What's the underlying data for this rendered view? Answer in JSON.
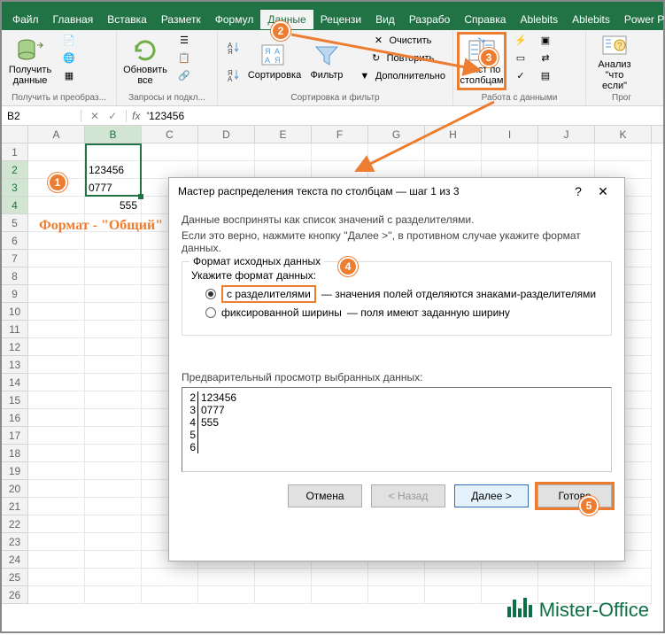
{
  "tabs": {
    "file": "Файл",
    "home": "Главная",
    "insert": "Вставка",
    "layout": "Разметк",
    "formulas": "Формул",
    "data": "Данные",
    "review": "Рецензи",
    "view": "Вид",
    "dev": "Разрабо",
    "help": "Справка",
    "ab1": "Ablebits",
    "ab2": "Ablebits",
    "pp": "Power Pi"
  },
  "ribbon": {
    "get_data": "Получить\nданные",
    "refresh": "Обновить\nвсе",
    "sort": "Сортировка",
    "filter": "Фильтр",
    "clear": "Очистить",
    "reapply": "Повторить",
    "advanced": "Дополнительно",
    "text_to_columns": "Текст по\nстолбцам",
    "whatif": "Анализ \"что\nесли\"",
    "group_get": "Получить и преобраз...",
    "group_queries": "Запросы и подкл...",
    "group_sort": "Сортировка и фильтр",
    "group_datatools": "Работа с данными",
    "group_forecast": "Прог"
  },
  "namebox": "B2",
  "formula": "'123456",
  "columns": [
    "A",
    "B",
    "C",
    "D",
    "E",
    "F",
    "G",
    "H",
    "I",
    "J",
    "K"
  ],
  "cells": {
    "B2": "123456",
    "B3": "0777",
    "B4": "555"
  },
  "annotation": "Формат - \"Общий\"",
  "dialog": {
    "title": "Мастер распределения текста по столбцам — шаг 1 из 3",
    "desc1": "Данные восприняты как список значений с разделителями.",
    "desc2": "Если это верно, нажмите кнопку ''Далее >'', в противном случае укажите формат данных.",
    "legend": "Формат исходных данных",
    "label": "Укажите формат данных:",
    "opt1": "с разделителями",
    "opt1_desc": "— значения полей отделяются знаками-разделителями",
    "opt2": "фиксированной ширины",
    "opt2_desc": "— поля имеют заданную ширину",
    "preview_label": "Предварительный просмотр выбранных данных:",
    "preview": [
      {
        "n": "2",
        "v": "123456"
      },
      {
        "n": "3",
        "v": "0777"
      },
      {
        "n": "4",
        "v": "555"
      },
      {
        "n": "5",
        "v": ""
      },
      {
        "n": "6",
        "v": ""
      }
    ],
    "btn_cancel": "Отмена",
    "btn_back": "< Назад",
    "btn_next": "Далее >",
    "btn_finish": "Готово"
  },
  "watermark": "Mister-Office",
  "callouts": {
    "1": "1",
    "2": "2",
    "3": "3",
    "4": "4",
    "5": "5"
  }
}
